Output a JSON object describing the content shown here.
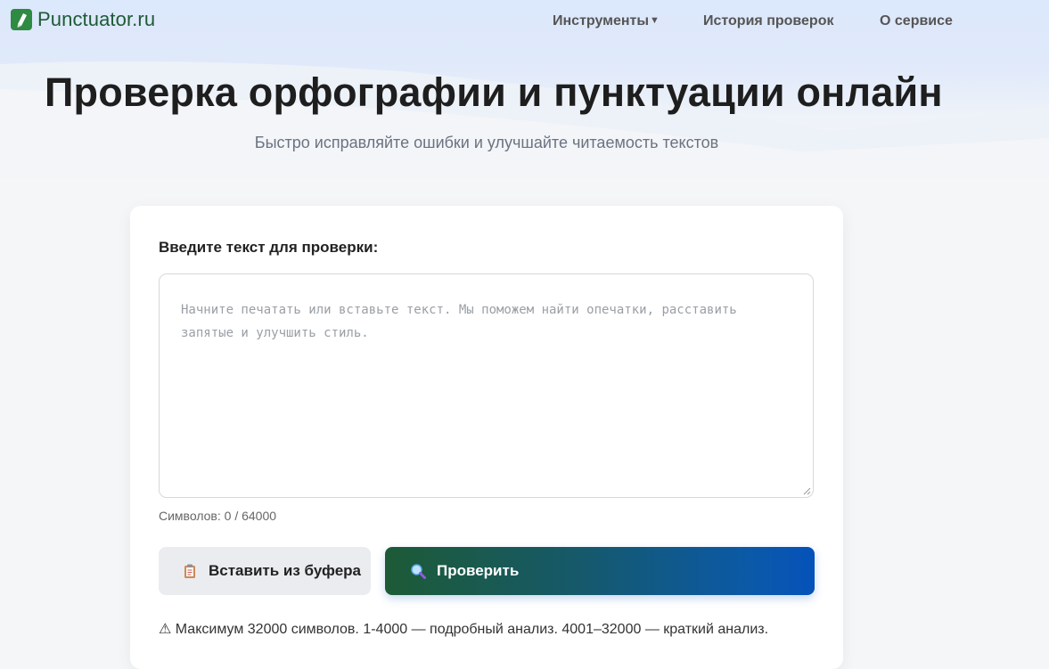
{
  "brand": {
    "name": "Punctuator.ru",
    "color": "#1e5a35"
  },
  "nav": {
    "items": [
      {
        "label": "Инструменты",
        "has_dropdown": true
      },
      {
        "label": "История проверок"
      },
      {
        "label": "О сервисе"
      }
    ]
  },
  "hero": {
    "title": "Проверка орфографии и пунктуации онлайн",
    "subtitle": "Быстро исправляйте ошибки и улучшайте читаемость текстов"
  },
  "form": {
    "label": "Введите текст для проверки:",
    "placeholder": "Начните печатать или вставьте текст. Мы поможем найти опечатки, расставить запятые и улучшить стиль.",
    "value": "",
    "counter": "Символов: 0 / 64000",
    "paste_button": {
      "label": "Вставить из буфера",
      "icon": "clipboard-icon"
    },
    "check_button": {
      "label": "Проверить",
      "icon": "magnifier-icon"
    },
    "notice_icon": "⚠",
    "notice": "Максимум 32000 символов. 1-4000 — подробный анализ. 4001–32000 — краткий анализ."
  },
  "colors": {
    "accent_green": "#1d5a36",
    "accent_blue": "#0552ba",
    "header_bg": "#dce8fb"
  }
}
